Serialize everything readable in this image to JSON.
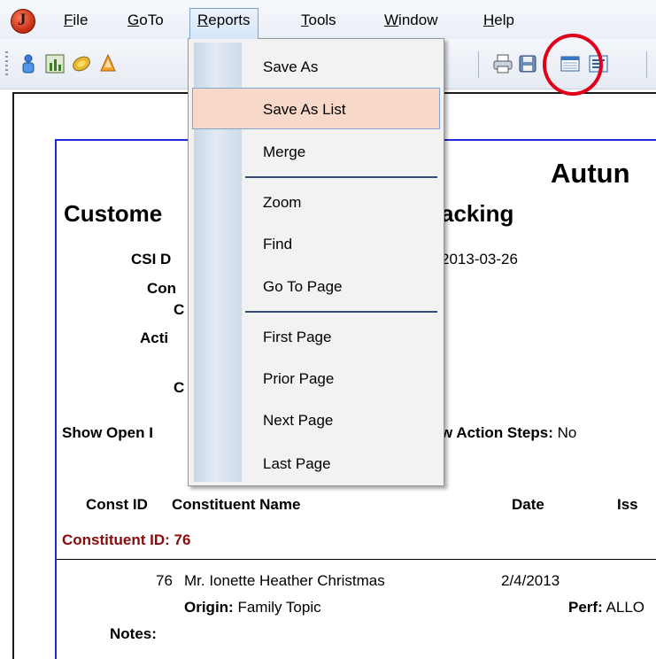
{
  "menubar": {
    "items": [
      {
        "label": "File",
        "accel": "F",
        "rest": "ile"
      },
      {
        "label": "GoTo",
        "accel": "G",
        "rest": "oTo"
      },
      {
        "label": "Reports",
        "accel": "R",
        "rest": "eports"
      },
      {
        "label": "Tools",
        "accel": "T",
        "rest": "ools"
      },
      {
        "label": "Window",
        "accel": "W",
        "rest": "indow"
      },
      {
        "label": "Help",
        "accel": "H",
        "rest": "elp"
      }
    ],
    "open_menu": "Reports"
  },
  "reports_menu": {
    "items": [
      {
        "label": "Save As"
      },
      {
        "label": "Save As List",
        "highlighted": true
      },
      {
        "label": "Merge"
      },
      {
        "label": "Zoom"
      },
      {
        "label": "Find"
      },
      {
        "label": "Go To Page"
      },
      {
        "label": "First Page"
      },
      {
        "label": "Prior Page"
      },
      {
        "label": "Next Page"
      },
      {
        "label": "Last Page"
      }
    ]
  },
  "report": {
    "title_visible": "Autun",
    "subtitle_left": "Custome",
    "subtitle_right": "acking",
    "params": {
      "csi_label": "CSI D",
      "csi_value": "2013-03-26",
      "con_label": "Con",
      "c1_label": "C",
      "acti_label": "Acti",
      "c2_label": "C"
    },
    "show_open_label": "Show Open I",
    "show_action_label": "w Action Steps:",
    "show_action_value": "No",
    "columns": {
      "const_id": "Const ID",
      "name": "Constituent Name",
      "date": "Date",
      "issue": "Iss"
    },
    "group_label": "Constituent ID: 76",
    "row": {
      "id": "76",
      "name": "Mr. Ionette Heather Christmas",
      "date": "2/4/2013",
      "origin_label": "Origin:",
      "origin_value": "Family Topic",
      "perf_label": "Perf:",
      "perf_value": "ALLO",
      "notes_label": "Notes:"
    }
  },
  "colors": {
    "accent_blue": "#1f2bd6",
    "highlight_red": "#e0001a",
    "group_maroon": "#8b0a0a"
  }
}
